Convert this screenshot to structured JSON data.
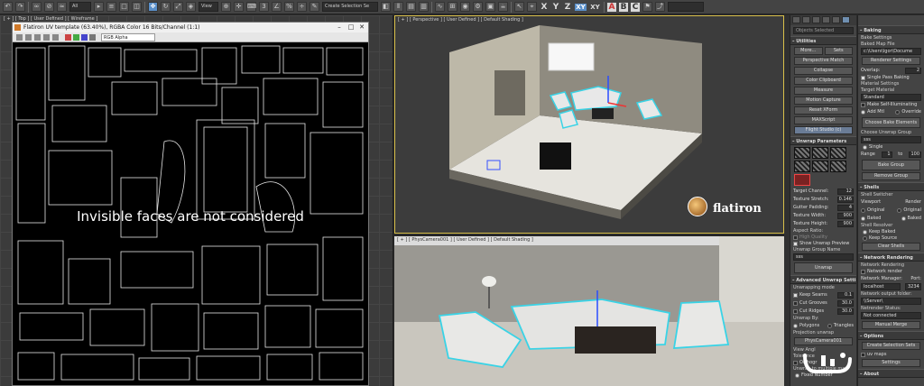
{
  "toolbar": {
    "selection_filter": "All",
    "view_dropdown": "View",
    "selection_set": "Create Selection Se",
    "axes": [
      "X",
      "Y",
      "Z",
      "XY",
      "XY"
    ],
    "abc": [
      "A",
      "B",
      "C"
    ]
  },
  "top_view": {
    "label": "[ + ] [ Top ] [ User Defined ] [ Wireframe ]"
  },
  "uv_editor": {
    "title": "Flatiron UV template (63.40%), RGBA Color 16 Bits/Channel (1:1)",
    "channel": "RGB Alpha",
    "message": "Invisible faces are not considered"
  },
  "perspective": {
    "label": "[ + ] [ Perspective ] [ User Defined ] [ Default Shading ]",
    "brand": "flatiron"
  },
  "camera": {
    "label": "[ + ] [ PhysCamera001 ] [ User Defined ] [ Default Shading ]"
  },
  "cmd": {
    "search_placeholder": "Objects Selected",
    "utilities": {
      "title": "Utilities",
      "more": "More...",
      "sets": "Sets",
      "buttons": [
        "Perspective Match",
        "Collapse",
        "Color Clipboard",
        "Measure",
        "Motion Capture",
        "Reset XForm",
        "MAXScript",
        "Flight Studio (c)"
      ]
    },
    "unwrap": {
      "title": "Unwrap Parameters",
      "rows": [
        {
          "label": "Target Channel:",
          "value": "12"
        },
        {
          "label": "Texture Stretch:",
          "value": "0.146"
        },
        {
          "label": "Gutter Padding:",
          "value": "4"
        },
        {
          "label": "Texture Width:",
          "value": "900"
        },
        {
          "label": "Texture Height:",
          "value": "900"
        }
      ],
      "aspect": "Aspect Ratio:",
      "high_quality": "High Quality",
      "show_preview": "Show Unwrap Preview",
      "group_name_label": "Unwrap Group Name",
      "group_name": "sss",
      "unwrap_btn": "Unwrap"
    },
    "advanced": {
      "title": "Advanced Unwrap Settin",
      "mode_label": "Unwrapping mode",
      "checks": [
        "Keep Seams",
        "Cut Grooves",
        "Cut Ridges"
      ],
      "spins": [
        "0.1",
        "30.0",
        "30.0"
      ],
      "unwrap_by": "Unwrap By:",
      "polygons": "Polygons",
      "triangles": "Triangles",
      "projection": "Projection unwrap",
      "camera": "PhysCamera001",
      "view_angle": "View Angl",
      "tolerance": "Tolerance",
      "ortho": "Orthogr",
      "multiple": "Unwrap to multiple map",
      "fixed": "Fixed Number"
    }
  },
  "cmd2": {
    "baking": {
      "title": "Baking",
      "settings": "Bake Settings",
      "baked_map_file": "Baked Map File",
      "path": "c:\\Users\\Igor\\Docume",
      "renderer_settings": "Renderer Settings",
      "overlap_label": "Overlap:",
      "overlap": "2",
      "single_pass": "Single Pass Baking",
      "material_settings": "Material Settings",
      "target_material": "Target Material",
      "standard": "Standard",
      "make_self": "Make Self-Illuminating",
      "add_mtl": "Add Mtl",
      "replace": "Override",
      "choose_bake": "Choose Bake Elements",
      "choose_group": "Choose Unwrap Group",
      "group_value": "sss",
      "single": "Single",
      "range_label": "Range",
      "range_from": "1",
      "to": "to",
      "range_to": "100",
      "bake_group": "Bake Group",
      "remove_group": "Remove Group"
    },
    "shells": {
      "title": "Shells",
      "switcher": "Shell Switcher",
      "viewport": "Viewport",
      "render": "Render",
      "original1": "Original",
      "original2": "Original",
      "baked1": "Baked",
      "baked2": "Baked",
      "resolver": "Shell Resolver",
      "keep_baked": "Keep Baked",
      "keep_source": "Keep Source",
      "clear": "Clear Shells"
    },
    "network": {
      "title": "Network Rendering",
      "sub": "Network Rendering",
      "net_render": "Network render",
      "manager": "Network Manager:",
      "port": "Port:",
      "host": "localhost",
      "port_value": "3234",
      "out_folder": "Network output folder:",
      "folder": "\\\\Server\\",
      "status_label": "Netrender Status:",
      "status": "Not connected",
      "manual_merge": "Manual Merge"
    },
    "options": {
      "title": "Options",
      "create_sets": "Create Selection Sets",
      "uv_maps": "uv maps",
      "settings": "Settings"
    },
    "about": {
      "title": "About"
    }
  }
}
